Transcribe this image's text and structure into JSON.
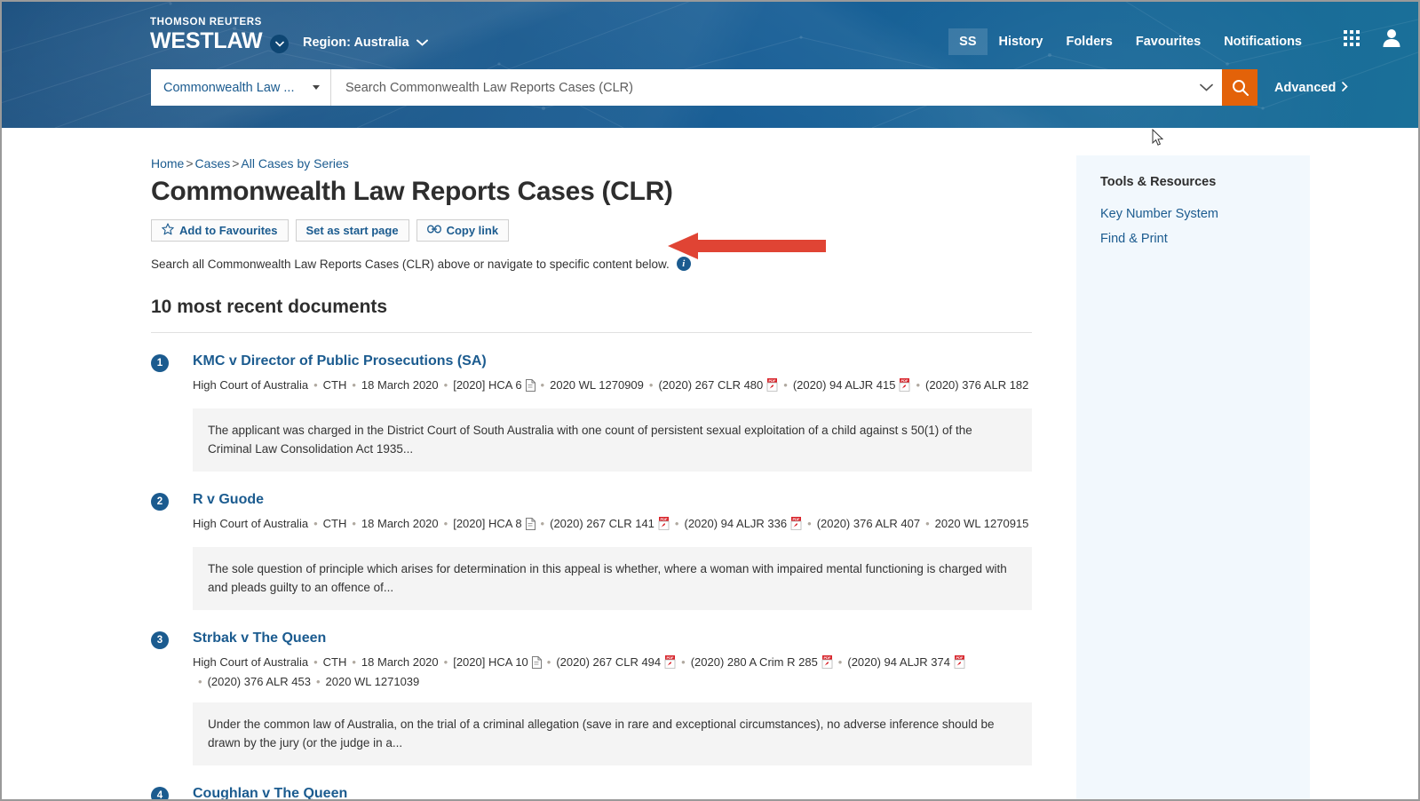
{
  "header": {
    "brand_top": "THOMSON REUTERS",
    "brand_main": "WESTLAW",
    "brand_caret_icon": "chevron-down-circle-icon",
    "region_label": "Region: Australia",
    "region_caret_icon": "chevron-down-icon",
    "nav": [
      {
        "label": "SS",
        "boxed": true
      },
      {
        "label": "History",
        "boxed": false
      },
      {
        "label": "Folders",
        "boxed": false
      },
      {
        "label": "Favourites",
        "boxed": false
      },
      {
        "label": "Notifications",
        "boxed": false
      }
    ],
    "apps_icon": "grid-apps-icon",
    "account_icon": "user-person-icon",
    "search": {
      "scope_label": "Commonwealth Law ...",
      "scope_caret_icon": "caret-down-icon",
      "placeholder": "Search Commonwealth Law Reports Cases (CLR)",
      "value": "",
      "dropdown_icon": "chevron-down-icon",
      "submit_icon": "search-magnifier-icon",
      "advanced_label": "Advanced",
      "advanced_caret_icon": "chevron-right-icon"
    }
  },
  "breadcrumb": {
    "items": [
      "Home",
      "Cases",
      "All Cases by Series"
    ],
    "separator": ">"
  },
  "page": {
    "title": "Commonwealth Law Reports Cases (CLR)",
    "actions": [
      {
        "label": "Add to Favourites",
        "icon": "star-outline-icon"
      },
      {
        "label": "Set as start page",
        "icon": ""
      },
      {
        "label": "Copy link",
        "icon": "link-chain-icon"
      }
    ],
    "description": "Search all Commonwealth Law Reports Cases (CLR) above or navigate to specific content below.",
    "info_icon": "info-circle-icon",
    "section_title": "10 most recent documents"
  },
  "results": [
    {
      "number": "1",
      "title": "KMC v Director of Public Prosecutions (SA)",
      "citations": [
        {
          "text": "High Court of Australia",
          "icon": ""
        },
        {
          "text": "CTH",
          "icon": ""
        },
        {
          "text": "18 March 2020",
          "icon": ""
        },
        {
          "text": "[2020] HCA 6",
          "icon": "document-icon"
        },
        {
          "text": "2020 WL 1270909",
          "icon": ""
        },
        {
          "text": "(2020) 267 CLR 480",
          "icon": "pdf-icon"
        },
        {
          "text": "(2020) 94 ALJR 415",
          "icon": "pdf-icon"
        },
        {
          "text": "(2020) 376 ALR 182",
          "icon": ""
        }
      ],
      "snippet": "The applicant was charged in the District Court of South Australia with one count of persistent sexual exploitation of a child against s 50(1) of the Criminal Law Consolidation Act 1935..."
    },
    {
      "number": "2",
      "title": "R v Guode",
      "citations": [
        {
          "text": "High Court of Australia",
          "icon": ""
        },
        {
          "text": "CTH",
          "icon": ""
        },
        {
          "text": "18 March 2020",
          "icon": ""
        },
        {
          "text": "[2020] HCA 8",
          "icon": "document-icon"
        },
        {
          "text": "(2020) 267 CLR 141",
          "icon": "pdf-icon"
        },
        {
          "text": "(2020) 94 ALJR 336",
          "icon": "pdf-icon"
        },
        {
          "text": "(2020) 376 ALR 407",
          "icon": ""
        },
        {
          "text": "2020 WL 1270915",
          "icon": ""
        }
      ],
      "snippet": "The sole question of principle which arises for determination in this appeal is whether, where a woman with impaired mental functioning is charged with and pleads guilty to an offence of..."
    },
    {
      "number": "3",
      "title": "Strbak v The Queen",
      "citations": [
        {
          "text": "High Court of Australia",
          "icon": ""
        },
        {
          "text": "CTH",
          "icon": ""
        },
        {
          "text": "18 March 2020",
          "icon": ""
        },
        {
          "text": "[2020] HCA 10",
          "icon": "document-icon"
        },
        {
          "text": "(2020) 267 CLR 494",
          "icon": "pdf-icon"
        },
        {
          "text": "(2020) 280 A Crim R 285",
          "icon": "pdf-icon"
        },
        {
          "text": "(2020) 94 ALJR 374",
          "icon": "pdf-icon"
        },
        {
          "text": "(2020) 376 ALR 453",
          "icon": ""
        },
        {
          "text": "2020 WL 1271039",
          "icon": ""
        }
      ],
      "snippet": "Under the common law of Australia, on the trial of a criminal allegation (save in rare and exceptional circumstances), no adverse inference should be drawn by the jury (or the judge in a..."
    },
    {
      "number": "4",
      "title": "Coughlan v The Queen",
      "citations": [],
      "snippet": ""
    }
  ],
  "sidebar": {
    "title": "Tools & Resources",
    "links": [
      "Key Number System",
      "Find & Print"
    ]
  },
  "annotation": {
    "arrow_color": "#e04434",
    "arrow_direction": "left"
  }
}
